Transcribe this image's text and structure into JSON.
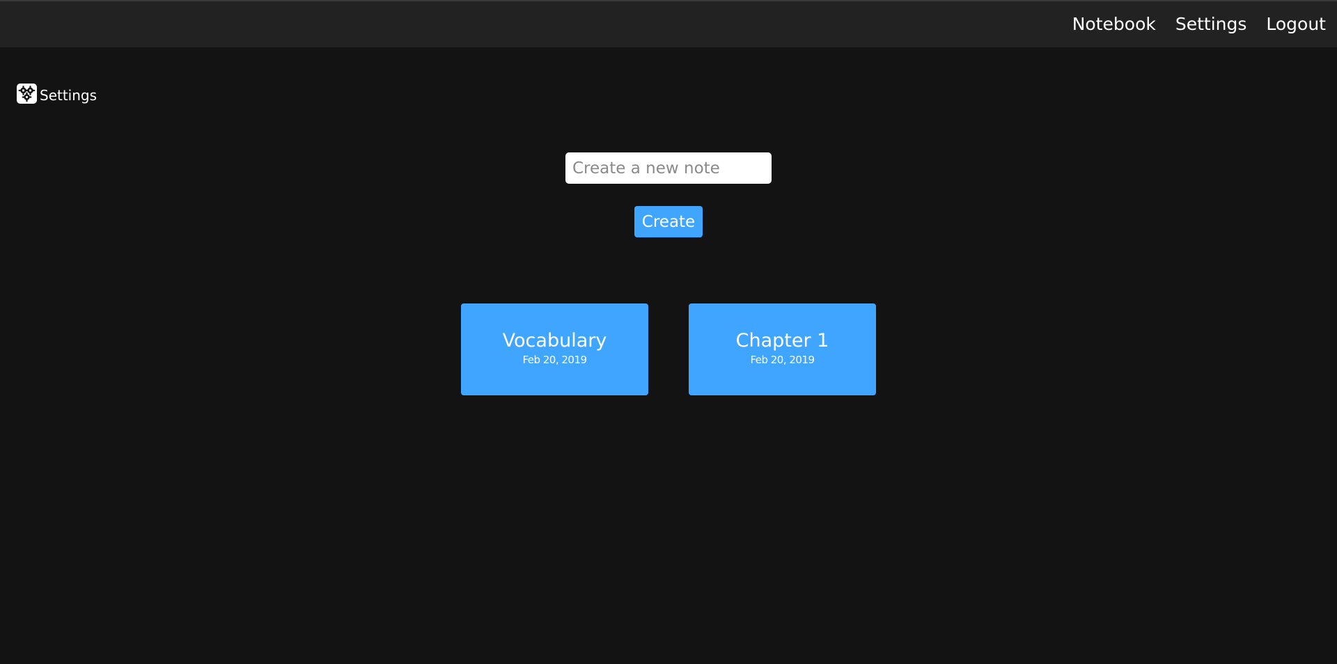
{
  "nav": {
    "items": [
      {
        "label": "Notebook"
      },
      {
        "label": "Settings"
      },
      {
        "label": "Logout"
      }
    ]
  },
  "sidebar": {
    "settings_label": "Settings",
    "settings_icon": "gears-icon"
  },
  "create": {
    "placeholder": "Create a new note",
    "value": "",
    "button_label": "Create"
  },
  "notes": [
    {
      "title": "Vocabulary",
      "date": "Feb 20, 2019"
    },
    {
      "title": "Chapter 1",
      "date": "Feb 20, 2019"
    }
  ],
  "colors": {
    "background": "#131313",
    "topbar": "#222222",
    "accent": "#40a5ff",
    "text": "#ffffff"
  }
}
